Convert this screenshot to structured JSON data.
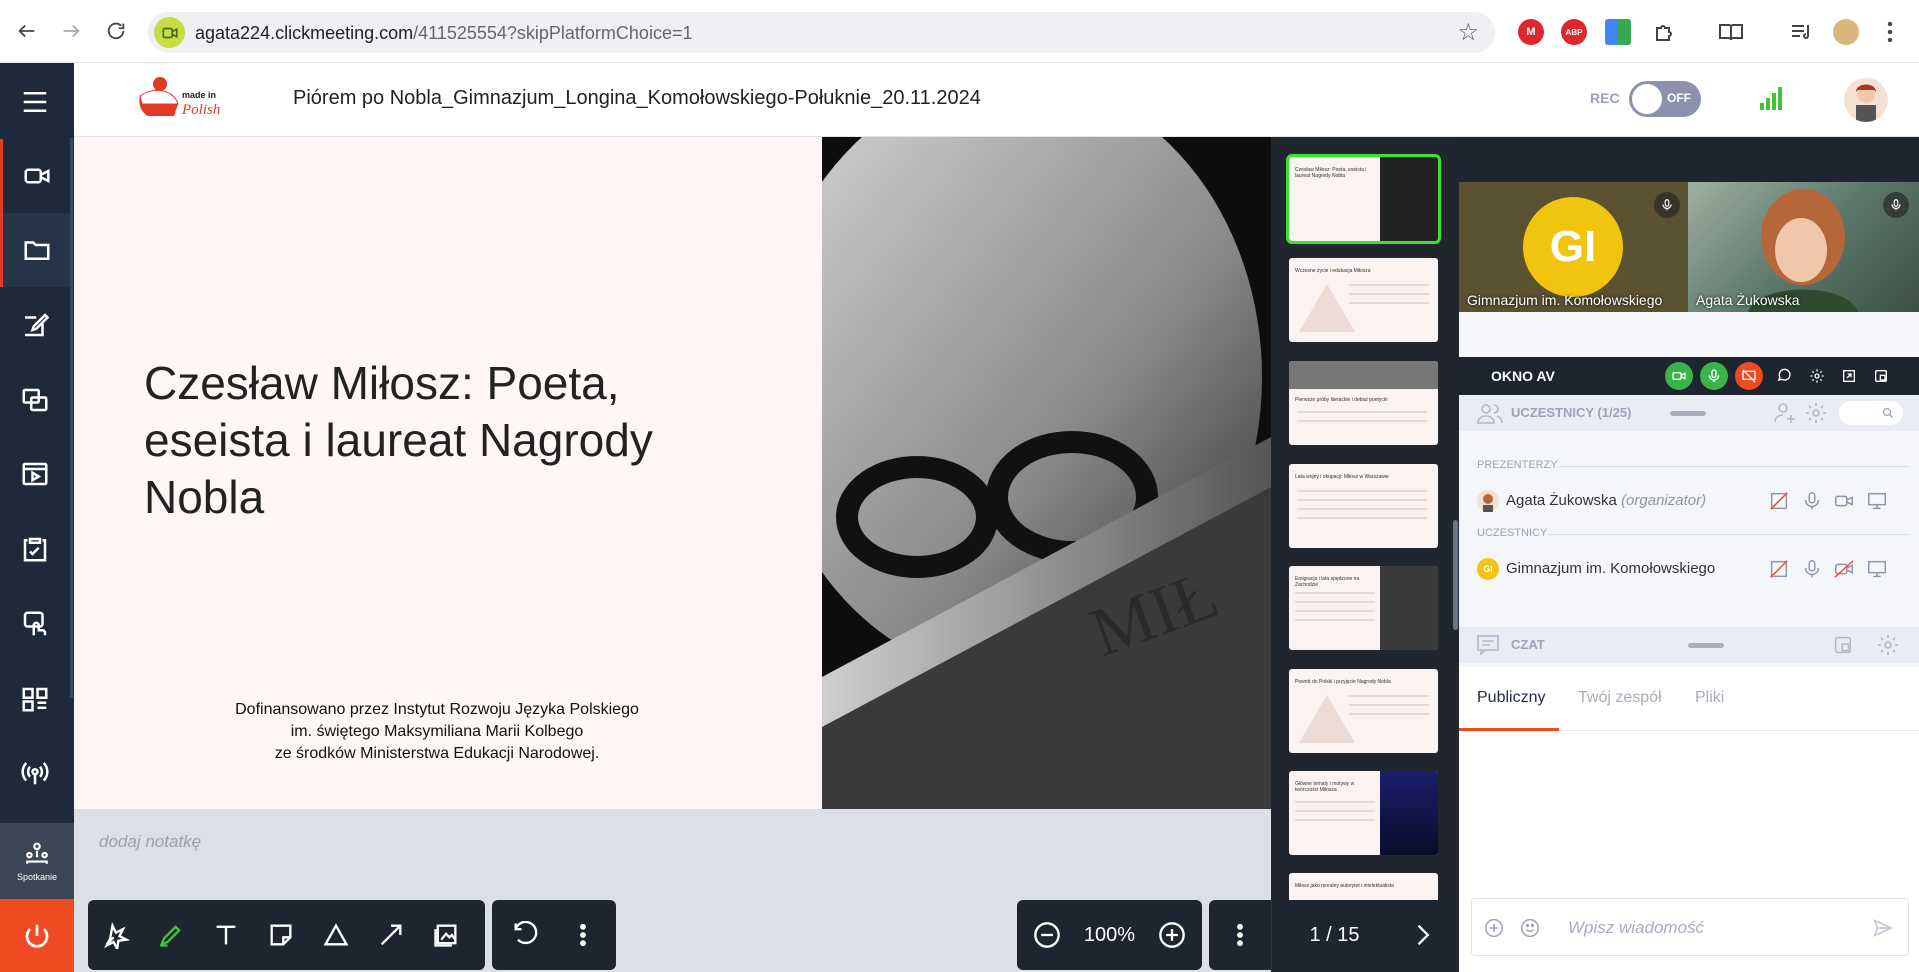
{
  "browser": {
    "url_domain": "agata224.clickmeeting.com",
    "url_path": "/411525554?skipPlatformChoice=1",
    "extensions": [
      {
        "name": "mail-extension-icon",
        "label": "M",
        "color": "#e0262d"
      },
      {
        "name": "adblock-plus-icon",
        "label": "ABP",
        "color": "#e0262d"
      },
      {
        "name": "google-extension-icon",
        "label": "",
        "color": "#4caf50"
      },
      {
        "name": "puzzle-extensions-icon",
        "label": "",
        "color": "#555"
      }
    ]
  },
  "header": {
    "logo_text": "made in Polish",
    "meeting_title": "Piórem po Nobla_Gimnazjum_Longina_Komołowskiego-Połuknie_20.11.2024",
    "rec_label": "REC",
    "rec_state": "OFF",
    "colors": {
      "rec_toggle": "#8c92ad",
      "signal": "#45c13b",
      "accent": "#f04a23"
    }
  },
  "sidebar": {
    "meeting_label": "Spotkanie",
    "items": [
      "camera-icon",
      "folder-icon",
      "edit-icon",
      "screenshare-icon",
      "video-player-icon",
      "clipboard-check-icon",
      "whiteboard-touch-icon",
      "apps-grid-icon",
      "broadcast-icon"
    ]
  },
  "slide": {
    "title": "Czesław Miłosz: Poeta, eseista i laureat Nagrody Nobla",
    "credit_line1": "Dofinansowano przez Instytut Rozwoju Języka Polskiego",
    "credit_line2": "im. świętego Maksymiliana Marii Kolbego",
    "credit_line3": "ze środków Ministerstwa Edukacji Narodowej.",
    "note_placeholder": "dodaj notatkę"
  },
  "thumbnails": [
    {
      "title": "Czesław Miłosz: Poeta, eseista i laureat Nagrody Nobla",
      "active": true
    },
    {
      "title": "Wczesne życie i edukacja Miłosza",
      "active": false
    },
    {
      "title": "Pierwsze próby literackie i debiut poetycki",
      "active": false
    },
    {
      "title": "Lata wojny i okupacji: Miłosz w Warszawie",
      "active": false
    },
    {
      "title": "Emigracja i lata spędzone na Zachodzie",
      "active": false
    },
    {
      "title": "Powrót do Polski i przyjęcie Nagrody Nobla",
      "active": false
    },
    {
      "title": "Główne tematy i motywy w twórczości Miłosza",
      "active": false
    },
    {
      "title": "Miłosz jako moralny autorytet i intelektualista",
      "active": false
    }
  ],
  "toolbar": {
    "zoom": "100%",
    "page": "1 / 15"
  },
  "av": {
    "tiles": [
      {
        "initials": "GI",
        "name": "Gimnazjum im. Komołowskiego"
      },
      {
        "name": "Agata Żukowska"
      }
    ],
    "window_label": "OKNO AV"
  },
  "participants": {
    "title": "UCZESTNICY (1/25)",
    "presenters_label": "PREZENTERZY",
    "attendees_label": "UCZESTNICY",
    "presenter_name": "Agata Żukowska",
    "presenter_role": "(organizator)",
    "attendee_initials": "GI",
    "attendee_name": "Gimnazjum im. Komołowskiego"
  },
  "chat": {
    "title": "CZAT",
    "tab_public": "Publiczny",
    "tab_team": "Twój zespół",
    "tab_files": "Pliki",
    "input_placeholder": "Wpisz wiadomość"
  }
}
